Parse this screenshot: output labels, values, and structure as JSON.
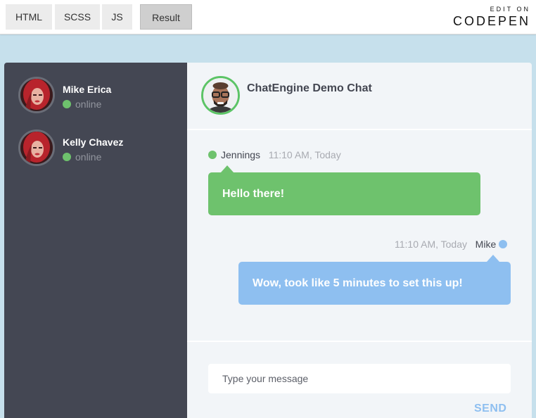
{
  "topbar": {
    "tabs": [
      {
        "label": "HTML"
      },
      {
        "label": "SCSS"
      },
      {
        "label": "JS"
      },
      {
        "label": "Result"
      }
    ],
    "brand_top": "EDIT ON",
    "brand_logo": "CODEPEN"
  },
  "people": [
    {
      "name": "Mike Erica",
      "status": "online"
    },
    {
      "name": "Kelly Chavez",
      "status": "online"
    }
  ],
  "chat": {
    "title": "ChatEngine Demo Chat",
    "messages": [
      {
        "sender": "Jennings",
        "time": "11:10 AM, Today",
        "text": "Hello there!"
      },
      {
        "sender": "Mike",
        "time": "11:10 AM, Today",
        "text": "Wow, took like 5 minutes to set this up!"
      }
    ],
    "input_placeholder": "Type your message",
    "send_label": "SEND"
  },
  "colors": {
    "sidebar_bg": "#444753",
    "chat_bg": "#f2f5f8",
    "online": "#6ec26d",
    "incoming_bubble": "#6ec26d",
    "outgoing_bubble": "#8ebff0",
    "page_bg": "#c6e0ec"
  }
}
